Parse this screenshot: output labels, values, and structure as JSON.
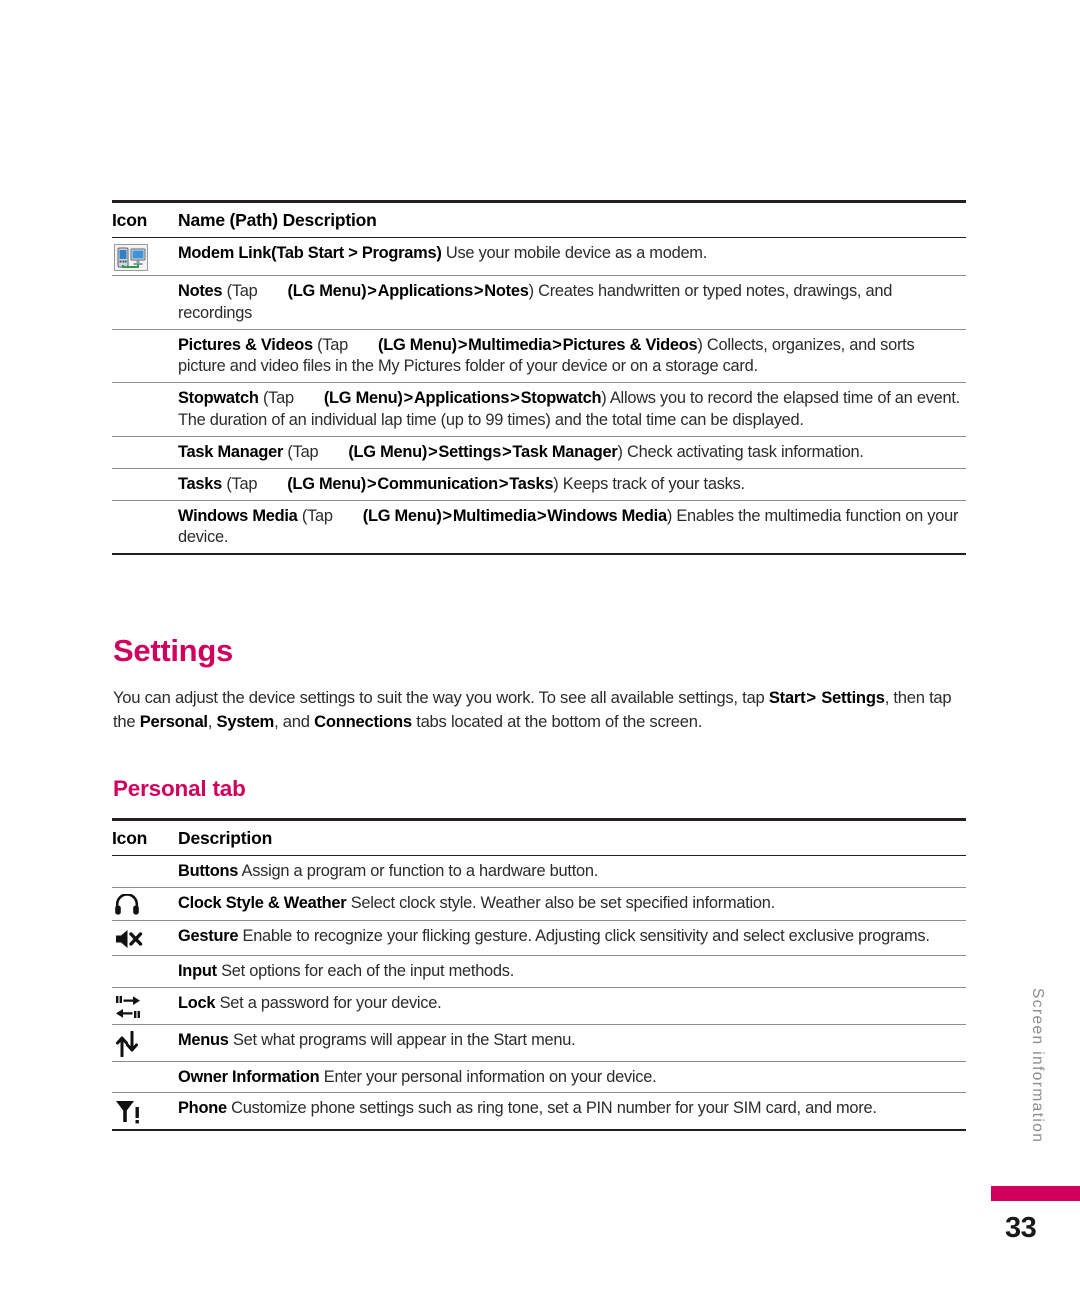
{
  "page": {
    "number": "33",
    "side_label": "Screen information",
    "accent_color": "#d1005d"
  },
  "programs_table": {
    "headers": {
      "icon": "Icon",
      "name": "Name (Path) Description"
    },
    "rows": [
      {
        "icon": "modem-link-icon",
        "name": "Modem Link",
        "path_open": "(Tab Start > Programs)",
        "tap": "",
        "menu": "",
        "crumbs": "",
        "desc": " Use your mobile device as a modem."
      },
      {
        "icon": "none",
        "name": "Notes",
        "tap": "(Tap",
        "menu": "(LG Menu)",
        "crumb1": "Applications",
        "crumb2": "Notes",
        "desc": " Creates handwritten or typed notes, drawings, and recordings"
      },
      {
        "icon": "none",
        "name": "Pictures & Videos",
        "tap": "(Tap",
        "menu": "(LG Menu)",
        "crumb1": "Multimedia",
        "crumb2": "Pictures & Videos",
        "desc": " Collects, organizes, and sorts picture and video files in the My Pictures folder of your device or on a storage card."
      },
      {
        "icon": "none",
        "name": "Stopwatch",
        "tap": "(Tap",
        "menu": "(LG Menu)",
        "crumb1": "Applications",
        "crumb2": "Stopwatch",
        "desc": " Allows you to record the elapsed time of an event. The duration of an individual lap time (up to 99 times) and the total time can be displayed."
      },
      {
        "icon": "none",
        "name": "Task Manager",
        "tap": "(Tap",
        "menu": "(LG Menu)",
        "crumb1": "Settings",
        "crumb2": "Task Manager",
        "desc": " Check activating task information."
      },
      {
        "icon": "none",
        "name": "Tasks",
        "tap": "(Tap",
        "menu": "(LG Menu)",
        "crumb1": "Communication",
        "crumb2": "Tasks",
        "desc": " Keeps track of your tasks."
      },
      {
        "icon": "none",
        "name": "Windows Media",
        "tap": "(Tap",
        "menu": "(LG Menu)",
        "crumb1": "Multimedia",
        "crumb2": "Windows Media",
        "desc": " Enables the multimedia function on your device."
      }
    ]
  },
  "settings_section": {
    "heading": "Settings",
    "paragraph_part1": "You can adjust the device settings to suit the way you work. To see all available settings, tap ",
    "paragraph_start": "Start",
    "paragraph_gt1": ">",
    "paragraph_settings": "Settings",
    "paragraph_part2": ", then tap the ",
    "paragraph_personal": "Personal",
    "paragraph_comma1": ", ",
    "paragraph_system": "System",
    "paragraph_and": ", and ",
    "paragraph_connections": "Connections",
    "paragraph_part3": " tabs located at the bottom of the screen.",
    "subheading": "Personal tab"
  },
  "personal_table": {
    "headers": {
      "icon": "Icon",
      "description": "Description"
    },
    "rows": [
      {
        "icon": "none",
        "name": "Buttons",
        "desc": " Assign a program or function to a hardware button."
      },
      {
        "icon": "headphone-icon",
        "name": "Clock Style & Weather",
        "desc": " Select clock style. Weather also be set specified information."
      },
      {
        "icon": "mute-speaker-icon",
        "name": "Gesture",
        "desc": " Enable to recognize your flicking gesture. Adjusting click sensitivity and select exclusive programs."
      },
      {
        "icon": "none",
        "name": "Input",
        "desc": " Set options for each of the input methods."
      },
      {
        "icon": "lock-arrows-icon",
        "name": "Lock",
        "desc": " Set a password for your device."
      },
      {
        "icon": "menus-arrows-icon",
        "name": "Menus",
        "desc": " Set what programs will appear in the Start menu."
      },
      {
        "icon": "none",
        "name": "Owner Information",
        "desc": " Enter your personal information on your device."
      },
      {
        "icon": "signal-alert-icon",
        "name": "Phone",
        "desc": " Customize phone settings such as ring tone, set a PIN number for your SIM card, and more."
      }
    ]
  }
}
